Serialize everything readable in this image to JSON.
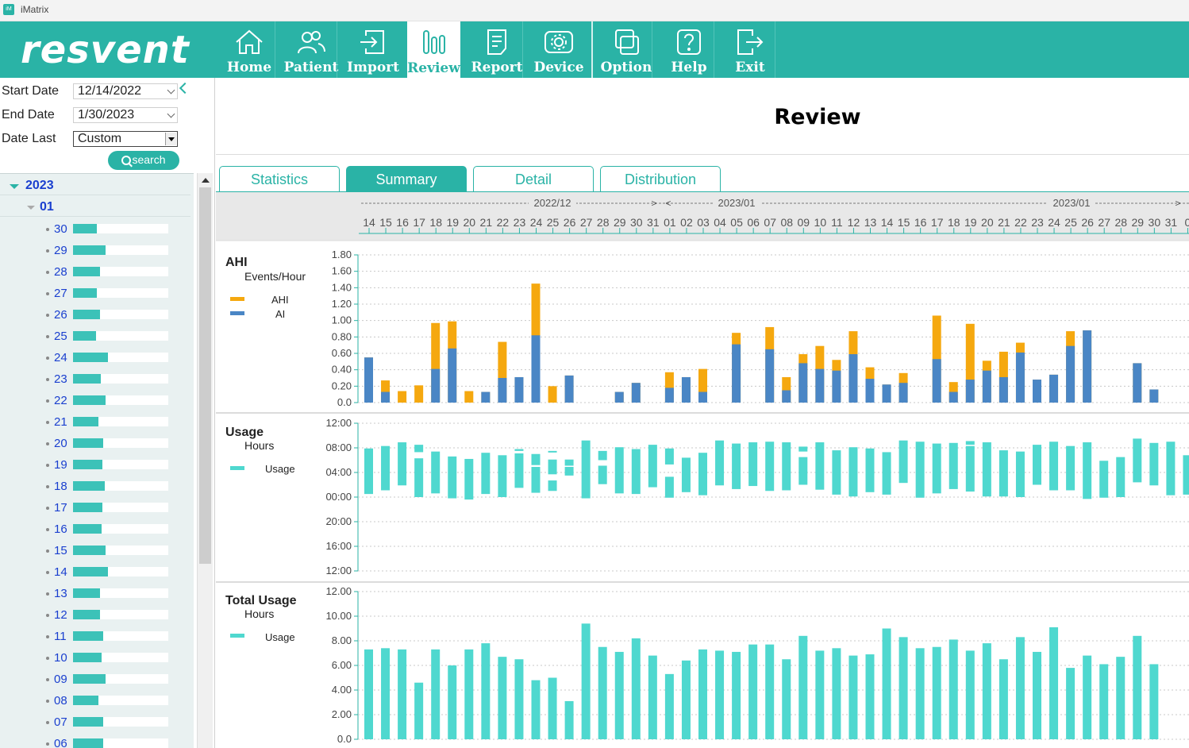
{
  "window": {
    "title": "iMatrix"
  },
  "toolbar": {
    "logo": "resvent",
    "buttons": [
      {
        "key": "home",
        "label": "Home"
      },
      {
        "key": "patient",
        "label": "Patient"
      },
      {
        "key": "import",
        "label": "Import"
      },
      {
        "key": "review",
        "label": "Review"
      },
      {
        "key": "report",
        "label": "Report"
      },
      {
        "key": "device",
        "label": "Device"
      },
      {
        "key": "option",
        "label": "Option"
      },
      {
        "key": "help",
        "label": "Help"
      },
      {
        "key": "exit",
        "label": "Exit"
      }
    ]
  },
  "filters": {
    "start_label": "Start Date",
    "start_value": "12/14/2022",
    "end_label": "End Date",
    "end_value": "1/30/2023",
    "last_label": "Date Last",
    "last_value": "Custom",
    "search_label": "search"
  },
  "tree": {
    "year": "2023",
    "month": "01",
    "days": [
      {
        "d": "30",
        "usage": 0.25
      },
      {
        "d": "29",
        "usage": 0.34
      },
      {
        "d": "28",
        "usage": 0.28
      },
      {
        "d": "27",
        "usage": 0.25
      },
      {
        "d": "26",
        "usage": 0.28
      },
      {
        "d": "25",
        "usage": 0.24
      },
      {
        "d": "24",
        "usage": 0.37
      },
      {
        "d": "23",
        "usage": 0.29
      },
      {
        "d": "22",
        "usage": 0.34
      },
      {
        "d": "21",
        "usage": 0.27
      },
      {
        "d": "20",
        "usage": 0.32
      },
      {
        "d": "19",
        "usage": 0.31
      },
      {
        "d": "18",
        "usage": 0.33
      },
      {
        "d": "17",
        "usage": 0.31
      },
      {
        "d": "16",
        "usage": 0.3
      },
      {
        "d": "15",
        "usage": 0.34
      },
      {
        "d": "14",
        "usage": 0.37
      },
      {
        "d": "13",
        "usage": 0.28
      },
      {
        "d": "12",
        "usage": 0.28
      },
      {
        "d": "11",
        "usage": 0.32
      },
      {
        "d": "10",
        "usage": 0.3
      },
      {
        "d": "09",
        "usage": 0.34
      },
      {
        "d": "08",
        "usage": 0.27
      },
      {
        "d": "07",
        "usage": 0.32
      },
      {
        "d": "06",
        "usage": 0.32
      }
    ]
  },
  "main": {
    "title": "Review",
    "tabs": [
      "Statistics",
      "Summary",
      "Detail",
      "Distribution"
    ],
    "active_tab": "Summary",
    "date_header": {
      "months": [
        {
          "text": "-------------------------------------2022/12-------------------> <-----------"
        },
        {
          "text": "2023/01-------------------------------------------------------------------------------------------2023/01-------------------> "
        }
      ],
      "month_labels": [
        "2022/12",
        "2023/01",
        "2023/01"
      ],
      "days": [
        "14",
        "15",
        "16",
        "17",
        "18",
        "19",
        "20",
        "21",
        "22",
        "23",
        "24",
        "25",
        "26",
        "27",
        "28",
        "29",
        "30",
        "31",
        "01",
        "02",
        "03",
        "04",
        "05",
        "06",
        "07",
        "08",
        "09",
        "10",
        "11",
        "12",
        "13",
        "14",
        "15",
        "16",
        "17",
        "18",
        "19",
        "20",
        "21",
        "22",
        "23",
        "24",
        "25",
        "26",
        "27",
        "28",
        "29",
        "30",
        "31",
        "0"
      ]
    }
  },
  "colors": {
    "brand": "#2ab3a6",
    "ahi": "#f5a80f",
    "ai": "#4a86c5",
    "usage": "#4fd8cf",
    "link": "#1a3fcf"
  },
  "chart_data": [
    {
      "type": "bar",
      "title": "AHI",
      "ylabel": "Events/Hour",
      "ylim": [
        0,
        1.8
      ],
      "yticks": [
        "0.0",
        "0.20",
        "0.40",
        "0.60",
        "0.80",
        "1.00",
        "1.20",
        "1.40",
        "1.60",
        "1.80"
      ],
      "x": [
        "12-14",
        "12-15",
        "12-16",
        "12-17",
        "12-18",
        "12-19",
        "12-20",
        "12-21",
        "12-22",
        "12-23",
        "12-24",
        "12-25",
        "12-26",
        "12-27",
        "12-28",
        "12-29",
        "12-30",
        "12-31",
        "01-01",
        "01-02",
        "01-03",
        "01-04",
        "01-05",
        "01-06",
        "01-07",
        "01-08",
        "01-09",
        "01-10",
        "01-11",
        "01-12",
        "01-13",
        "01-14",
        "01-15",
        "01-16",
        "01-17",
        "01-18",
        "01-19",
        "01-20",
        "01-21",
        "01-22",
        "01-23",
        "01-24",
        "01-25",
        "01-26",
        "01-27",
        "01-28",
        "01-29",
        "01-30"
      ],
      "series": [
        {
          "name": "AHI",
          "values": [
            0.55,
            0.27,
            0.14,
            0.21,
            0.97,
            0.99,
            0.14,
            0.13,
            0.74,
            0.31,
            1.45,
            0.2,
            0.33,
            0,
            0,
            0.13,
            0.24,
            0,
            0.37,
            0.31,
            0.41,
            0,
            0.85,
            0,
            0.92,
            0.31,
            0.59,
            0.69,
            0.52,
            0.87,
            0.43,
            0.22,
            0.36,
            0,
            1.06,
            0.25,
            0.96,
            0.51,
            0.62,
            0.73,
            0.28,
            0.34,
            0.87,
            0.88,
            0,
            0,
            0.48,
            0.16
          ]
        },
        {
          "name": "AI",
          "values": [
            0.55,
            0.13,
            0,
            0,
            0.41,
            0.66,
            0,
            0.13,
            0.3,
            0.31,
            0.82,
            0,
            0.33,
            0,
            0,
            0.13,
            0.24,
            0,
            0.18,
            0.31,
            0.13,
            0,
            0.71,
            0,
            0.65,
            0.15,
            0.48,
            0.41,
            0.39,
            0.59,
            0.29,
            0.22,
            0.24,
            0,
            0.53,
            0.13,
            0.28,
            0.39,
            0.31,
            0.61,
            0.28,
            0.34,
            0.69,
            0.88,
            0,
            0,
            0.48,
            0.16
          ]
        }
      ]
    },
    {
      "type": "bar",
      "title": "Usage",
      "ylabel": "Hours",
      "yticks": [
        "12:00",
        "16:00",
        "20:00",
        "00:00",
        "04:00",
        "08:00",
        "12:00"
      ],
      "note": "values are start/end times in hours relative to 12:00 (noon) of the previous day",
      "series": [
        {
          "name": "Usage",
          "segments": [
            [
              [
                12.5,
                19.9
              ]
            ],
            [
              [
                13.1,
                20.3
              ]
            ],
            [
              [
                13.9,
                20.9
              ]
            ],
            [
              [
                12.0,
                18.3
              ],
              [
                19.3,
                20.5
              ]
            ],
            [
              [
                12.6,
                19.4
              ]
            ],
            [
              [
                11.8,
                18.6
              ]
            ],
            [
              [
                11.6,
                18.2
              ]
            ],
            [
              [
                12.5,
                19.2
              ]
            ],
            [
              [
                12.0,
                18.8
              ]
            ],
            [
              [
                13.5,
                19.1
              ],
              [
                19.5,
                19.8
              ]
            ],
            [
              [
                12.7,
                16.9
              ],
              [
                17.2,
                19.0
              ]
            ],
            [
              [
                13.0,
                14.7
              ],
              [
                15.7,
                18.1
              ],
              [
                19.3,
                19.5
              ]
            ],
            [
              [
                15.5,
                16.9
              ],
              [
                17.1,
                18.1
              ]
            ],
            [
              [
                11.8,
                21.2
              ]
            ],
            [
              [
                14.1,
                17.1
              ],
              [
                18.0,
                19.5
              ]
            ],
            [
              [
                12.6,
                20.1
              ]
            ],
            [
              [
                12.5,
                19.8
              ]
            ],
            [
              [
                13.6,
                20.5
              ]
            ],
            [
              [
                11.9,
                15.3
              ],
              [
                17.3,
                19.9
              ]
            ],
            [
              [
                12.8,
                18.4
              ]
            ],
            [
              [
                12.3,
                19.2
              ]
            ],
            [
              [
                13.9,
                21.2
              ]
            ],
            [
              [
                13.3,
                20.7
              ]
            ],
            [
              [
                13.8,
                20.9
              ]
            ],
            [
              [
                13.0,
                21.0
              ]
            ],
            [
              [
                13.1,
                20.9
              ]
            ],
            [
              [
                14.0,
                18.5
              ],
              [
                19.4,
                20.2
              ]
            ],
            [
              [
                13.2,
                20.9
              ]
            ],
            [
              [
                12.4,
                19.6
              ]
            ],
            [
              [
                12.1,
                20.1
              ]
            ],
            [
              [
                12.8,
                19.9
              ]
            ],
            [
              [
                12.4,
                19.3
              ]
            ],
            [
              [
                14.3,
                21.2
              ]
            ],
            [
              [
                11.9,
                21.0
              ]
            ],
            [
              [
                12.6,
                20.7
              ]
            ],
            [
              [
                13.3,
                20.8
              ]
            ],
            [
              [
                12.9,
                20.3
              ],
              [
                20.5,
                21.1
              ]
            ],
            [
              [
                12.1,
                20.9
              ]
            ],
            [
              [
                12.1,
                19.6
              ]
            ],
            [
              [
                12.0,
                19.4
              ]
            ],
            [
              [
                14.0,
                20.5
              ]
            ],
            [
              [
                13.1,
                21.0
              ]
            ],
            [
              [
                13.1,
                20.3
              ]
            ],
            [
              [
                11.7,
                20.9
              ]
            ],
            [
              [
                11.9,
                17.9
              ]
            ],
            [
              [
                12.0,
                18.5
              ]
            ],
            [
              [
                14.4,
                21.5
              ]
            ],
            [
              [
                13.9,
                20.8
              ]
            ],
            [
              [
                12.3,
                21.0
              ]
            ],
            [
              [
                12.4,
                18.8
              ]
            ]
          ]
        }
      ]
    },
    {
      "type": "bar",
      "title": "Total Usage",
      "ylabel": "Hours",
      "ylim": [
        0,
        12
      ],
      "yticks": [
        "0.0",
        "2.00",
        "4.00",
        "6.00",
        "8.00",
        "10.00",
        "12.00"
      ],
      "series": [
        {
          "name": "Usage",
          "values": [
            7.3,
            7.4,
            7.3,
            4.6,
            7.3,
            6.0,
            7.3,
            7.8,
            6.7,
            6.5,
            4.8,
            5.0,
            3.1,
            9.4,
            7.5,
            7.1,
            8.2,
            6.8,
            5.3,
            6.4,
            7.3,
            7.2,
            7.1,
            7.7,
            7.7,
            6.5,
            8.4,
            7.2,
            7.4,
            6.8,
            6.9,
            9.0,
            8.3,
            7.4,
            7.5,
            8.1,
            7.2,
            7.8,
            6.5,
            8.3,
            7.1,
            9.1,
            5.8,
            6.8,
            6.1,
            6.7,
            8.4,
            6.1
          ]
        }
      ]
    }
  ]
}
